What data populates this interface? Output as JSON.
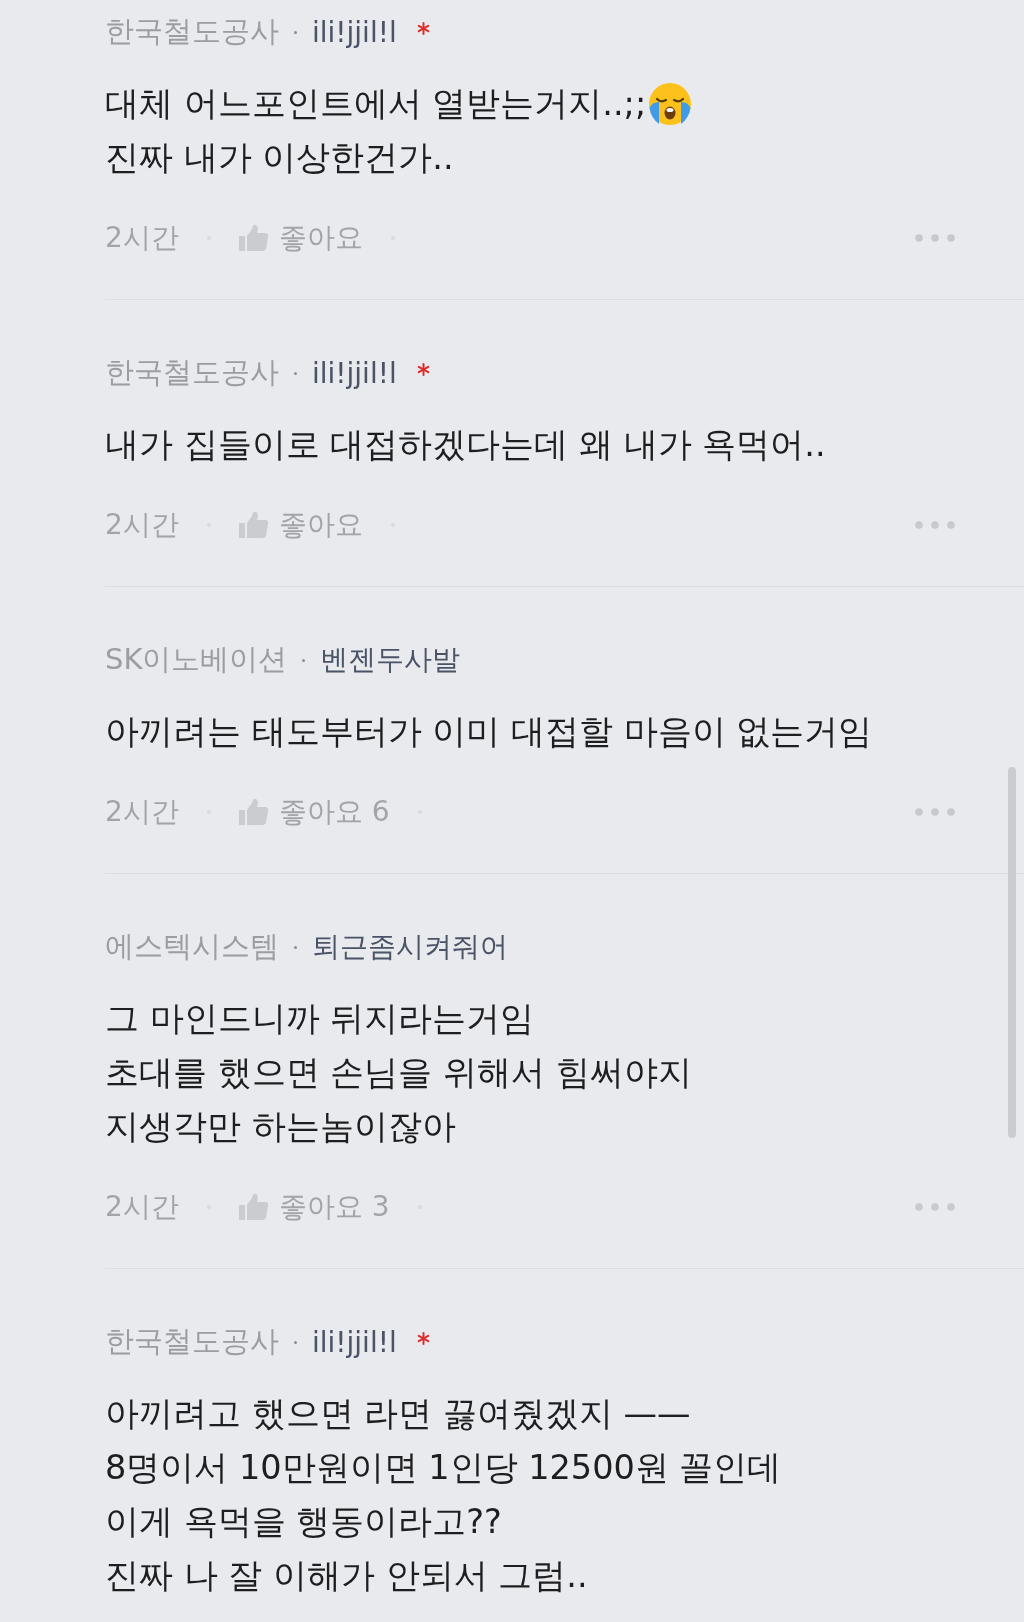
{
  "comments": [
    {
      "company": "한국철도공사",
      "nickname": "ili!jjil!l",
      "author_mark": true,
      "lines": [
        {
          "text": "대체 어느포인트에서 열받는거지..;;",
          "emoji": true
        },
        {
          "text": "진짜 내가 이상한건가..",
          "emoji": false
        }
      ],
      "time": "2시간",
      "like": {
        "label": "좋아요"
      }
    },
    {
      "company": "한국철도공사",
      "nickname": "ili!jjil!l",
      "author_mark": true,
      "lines": [
        {
          "text": "내가 집들이로 대접하겠다는데 왜 내가 욕먹어..",
          "emoji": false
        }
      ],
      "time": "2시간",
      "like": {
        "label": "좋아요"
      }
    },
    {
      "company": "SK이노베이션",
      "nickname": "벤젠두사발",
      "author_mark": false,
      "lines": [
        {
          "text": "아끼려는 태도부터가 이미 대접할 마음이 없는거임",
          "emoji": false
        }
      ],
      "time": "2시간",
      "like": {
        "label": "좋아요",
        "count": "6"
      }
    },
    {
      "company": "에스텍시스템",
      "nickname": "퇴근좀시켜줘어",
      "author_mark": false,
      "lines": [
        {
          "text": "그 마인드니까 뒤지라는거임",
          "emoji": false
        },
        {
          "text": "초대를 했으면 손님을 위해서 힘써야지",
          "emoji": false
        },
        {
          "text": "지생각만 하는놈이잖아",
          "emoji": false
        }
      ],
      "time": "2시간",
      "like": {
        "label": "좋아요",
        "count": "3"
      }
    },
    {
      "company": "한국철도공사",
      "nickname": "ili!jjil!l",
      "author_mark": true,
      "lines": [
        {
          "text": "아끼려고 했으면 라면 끓여줬겠지 ——",
          "emoji": false
        },
        {
          "text": "8명이서 10만원이면 1인당 12500원 꼴인데",
          "emoji": false
        },
        {
          "text": "이게 욕먹을 행동이라고??",
          "emoji": false
        },
        {
          "text": "진짜 나 잘 이해가 안되서 그럼..",
          "emoji": false
        }
      ]
    }
  ]
}
